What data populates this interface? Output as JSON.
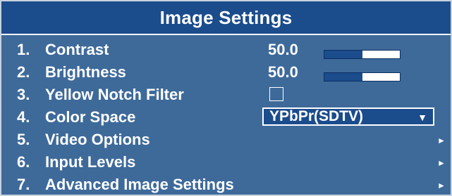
{
  "title": "Image Settings",
  "menu": {
    "items": [
      {
        "number": "1.",
        "label": "Contrast",
        "value": "50.0",
        "level": 0.5
      },
      {
        "number": "2.",
        "label": "Brightness",
        "value": "50.0",
        "level": 0.5
      },
      {
        "number": "3.",
        "label": "Yellow Notch Filter",
        "checked": false
      },
      {
        "number": "4.",
        "label": "Color Space",
        "selected": "YPbPr(SDTV)",
        "caret": "▼"
      },
      {
        "number": "5.",
        "label": "Video Options",
        "arrow": "►"
      },
      {
        "number": "6.",
        "label": "Input Levels",
        "arrow": "►"
      },
      {
        "number": "7.",
        "label": "Advanced Image Settings",
        "arrow": "►"
      }
    ]
  },
  "colors": {
    "background": "#3e6a9a",
    "title_bar": "#1b4c8c",
    "slider_fill": "#1b4c8c",
    "text": "#ffffff"
  },
  "icons": {
    "dropdown": "triangle-down-icon",
    "submenu": "triangle-right-icon"
  }
}
